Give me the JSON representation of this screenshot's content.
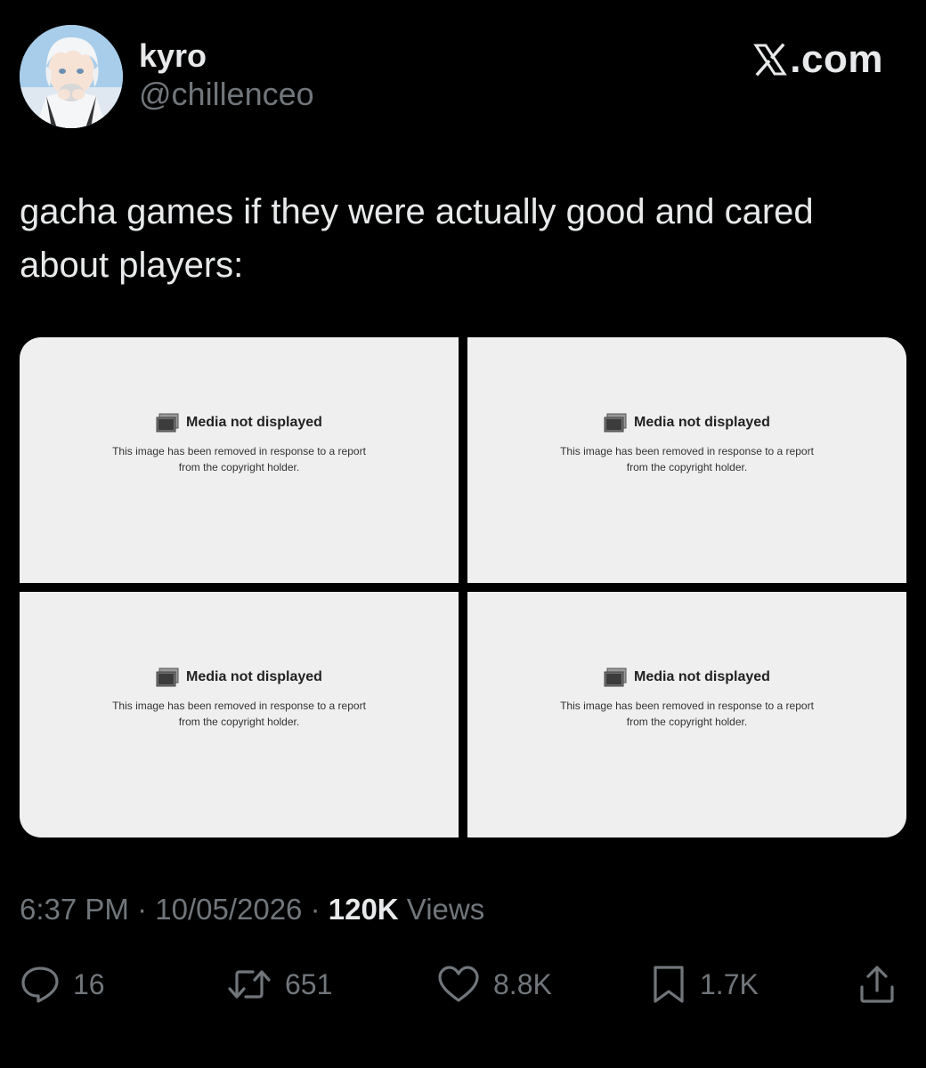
{
  "header": {
    "display_name": "kyro",
    "handle": "@chillenceo",
    "brand": ".com",
    "avatar_icon": "anime-avatar"
  },
  "tweet": {
    "text": "gacha games if they were actually good and cared about players:"
  },
  "media": [
    {
      "title": "Media not displayed",
      "description": "This image has been removed in response to a report from the copyright holder.",
      "icon": "image-placeholder-icon"
    },
    {
      "title": "Media not displayed",
      "description": "This image has been removed in response to a report from the copyright holder.",
      "icon": "image-placeholder-icon"
    },
    {
      "title": "Media not displayed",
      "description": "This image has been removed in response to a report from the copyright holder.",
      "icon": "image-placeholder-icon"
    },
    {
      "title": "Media not displayed",
      "description": "This image has been removed in response to a report from the copyright holder.",
      "icon": "image-placeholder-icon"
    }
  ],
  "meta": {
    "time": "6:37 PM",
    "separator": " · ",
    "date": "10/05/2026",
    "views_count": "120K",
    "views_label": " Views"
  },
  "actions": {
    "replies": "16",
    "reposts": "651",
    "likes": "8.8K",
    "bookmarks": "1.7K"
  },
  "colors": {
    "background": "#000000",
    "primary_text": "#e7e9ea",
    "secondary_text": "#71767b",
    "placeholder_bg": "#efefef"
  }
}
